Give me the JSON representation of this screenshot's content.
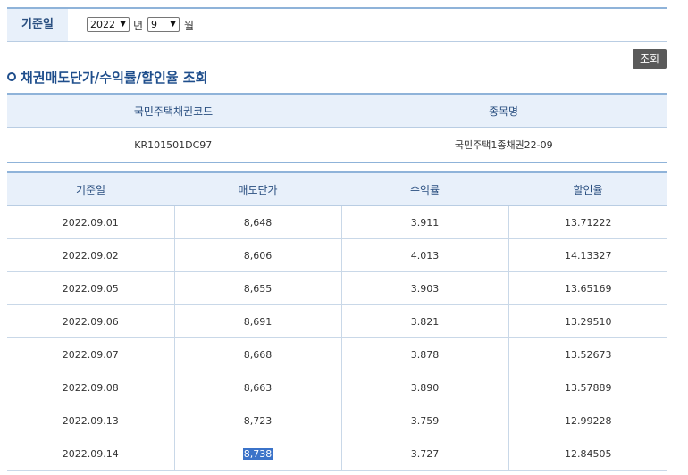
{
  "filter": {
    "label": "기준일",
    "year": "2022",
    "year_unit": "년",
    "month": "9",
    "month_unit": "월"
  },
  "query_button": "조회",
  "section_title": "채권매도단가/수익률/할인율 조회",
  "bond_info": {
    "headers": [
      "국민주택채권코드",
      "종목명"
    ],
    "code": "KR101501DC97",
    "name": "국민주택1종채권22-09"
  },
  "price_table": {
    "headers": [
      "기준일",
      "매도단가",
      "수익률",
      "할인율"
    ],
    "rows": [
      [
        "2022.09.01",
        "8,648",
        "3.911",
        "13.71222"
      ],
      [
        "2022.09.02",
        "8,606",
        "4.013",
        "14.13327"
      ],
      [
        "2022.09.05",
        "8,655",
        "3.903",
        "13.65169"
      ],
      [
        "2022.09.06",
        "8,691",
        "3.821",
        "13.29510"
      ],
      [
        "2022.09.07",
        "8,668",
        "3.878",
        "13.52673"
      ],
      [
        "2022.09.08",
        "8,663",
        "3.890",
        "13.57889"
      ],
      [
        "2022.09.13",
        "8,723",
        "3.759",
        "12.99228"
      ],
      [
        "2022.09.14",
        "8,738",
        "3.727",
        "12.84505"
      ]
    ]
  }
}
